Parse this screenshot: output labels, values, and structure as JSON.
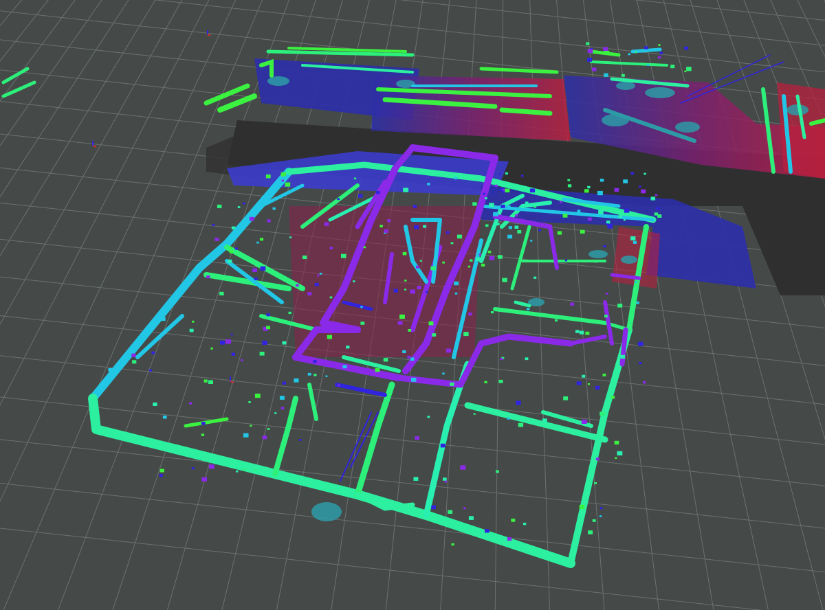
{
  "viewport": {
    "background_color": "#454a49",
    "grid_color": "#8c9191",
    "scene_type": "3d-occupancy-point-cloud-map"
  },
  "layers": {
    "occupancy_grid": {
      "free_color": "#2f2f30",
      "unknown_color": "#454a49"
    },
    "costmap": {
      "low_cost_color": "#2b2fa8",
      "high_cost_color": "#b8203f",
      "inflation_color": "#3c3ccc"
    },
    "point_cloud": {
      "height_colormap": [
        "#8a2ae8",
        "#3024e0",
        "#22c7e6",
        "#29f0b0",
        "#2cf07a",
        "#3af23f"
      ]
    },
    "footprints": {
      "color": "#2d9ba6"
    }
  },
  "icons": {
    "robot_axis_markers": [
      "axis-marker-icon",
      "axis-marker-icon",
      "axis-marker-icon"
    ]
  }
}
